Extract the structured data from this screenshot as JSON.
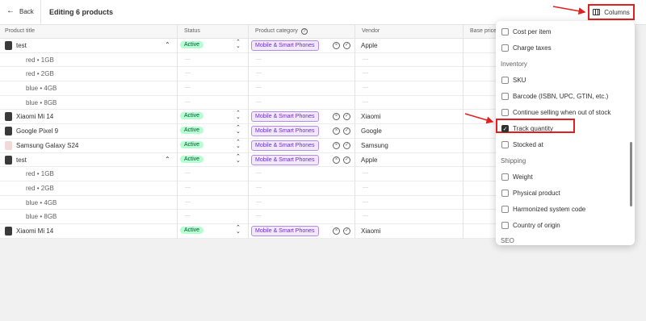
{
  "topbar": {
    "back_label": "Back",
    "title": "Editing 6 products",
    "columns_label": "Columns"
  },
  "table": {
    "headers": {
      "product_title": "Product title",
      "status": "Status",
      "category": "Product category",
      "vendor": "Vendor",
      "base_price": "Base price"
    },
    "rows": [
      {
        "kind": "product",
        "title": "test",
        "status": "Active",
        "category": "Mobile & Smart Phones",
        "vendor": "Apple",
        "thumb": "dark",
        "expanded": true
      },
      {
        "kind": "variant",
        "title": "red • 1GB"
      },
      {
        "kind": "variant",
        "title": "red • 2GB"
      },
      {
        "kind": "variant",
        "title": "blue • 4GB"
      },
      {
        "kind": "variant",
        "title": "blue • 8GB"
      },
      {
        "kind": "product",
        "title": "Xiaomi Mi 14",
        "status": "Active",
        "category": "Mobile & Smart Phones",
        "vendor": "Xiaomi",
        "thumb": "dark"
      },
      {
        "kind": "product",
        "title": "Google Pixel 9",
        "status": "Active",
        "category": "Mobile & Smart Phones",
        "vendor": "Google",
        "thumb": "dark"
      },
      {
        "kind": "product",
        "title": "Samsung Galaxy S24",
        "status": "Active",
        "category": "Mobile & Smart Phones",
        "vendor": "Samsung",
        "thumb": "pink"
      },
      {
        "kind": "product",
        "title": "test",
        "status": "Active",
        "category": "Mobile & Smart Phones",
        "vendor": "Apple",
        "thumb": "dark",
        "expanded": true
      },
      {
        "kind": "variant",
        "title": "red • 1GB"
      },
      {
        "kind": "variant",
        "title": "red • 2GB"
      },
      {
        "kind": "variant",
        "title": "blue • 4GB"
      },
      {
        "kind": "variant",
        "title": "blue • 8GB"
      },
      {
        "kind": "product",
        "title": "Xiaomi Mi 14",
        "status": "Active",
        "category": "Mobile & Smart Phones",
        "vendor": "Xiaomi",
        "thumb": "dark"
      }
    ]
  },
  "columns_popover": {
    "items": [
      {
        "type": "option",
        "label": "Cost per item",
        "checked": false
      },
      {
        "type": "option",
        "label": "Charge taxes",
        "checked": false
      },
      {
        "type": "section",
        "label": "Inventory"
      },
      {
        "type": "option",
        "label": "SKU",
        "checked": false
      },
      {
        "type": "option",
        "label": "Barcode (ISBN, UPC, GTIN, etc.)",
        "checked": false
      },
      {
        "type": "option",
        "label": "Continue selling when out of stock",
        "checked": false
      },
      {
        "type": "option",
        "label": "Track quantity",
        "checked": true
      },
      {
        "type": "option",
        "label": "Stocked at",
        "checked": false
      },
      {
        "type": "section",
        "label": "Shipping"
      },
      {
        "type": "option",
        "label": "Weight",
        "checked": false
      },
      {
        "type": "option",
        "label": "Physical product",
        "checked": false
      },
      {
        "type": "option",
        "label": "Harmonized system code",
        "checked": false
      },
      {
        "type": "option",
        "label": "Country of origin",
        "checked": false
      },
      {
        "type": "section",
        "label": "SEO"
      }
    ]
  },
  "colors": {
    "annotation_red": "#e02020",
    "status_badge_bg": "#b4fed2",
    "category_tag_bg": "#f1e8fb",
    "category_tag_border": "#b58be8"
  }
}
